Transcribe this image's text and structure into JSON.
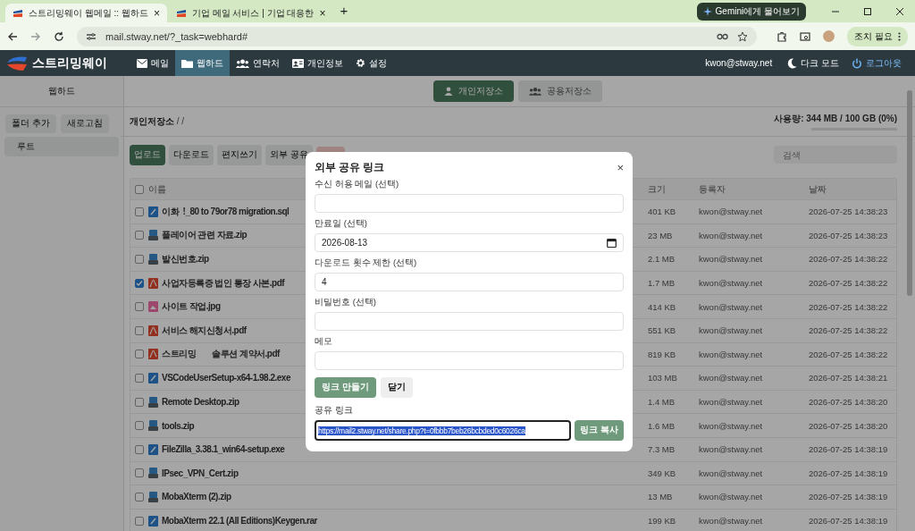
{
  "browser": {
    "tabs": [
      {
        "title": "스트리밍웨이 웹메일 :: 웹하드",
        "selected": true,
        "close": "×"
      },
      {
        "title": "기업 메일 서비스 | 기업 대응한",
        "selected": false,
        "close": "×"
      }
    ],
    "new_tab": "+",
    "gemini_button": "Gemini에게 물어보기",
    "address": "mail.stway.net/?_task=webhard#",
    "action_button": "조치 필요"
  },
  "navbar": {
    "brand": "스트리밍웨이",
    "items": [
      {
        "label": "메일",
        "selected": false
      },
      {
        "label": "웹하드",
        "selected": true
      },
      {
        "label": "연락처",
        "selected": false
      },
      {
        "label": "개인정보",
        "selected": false
      },
      {
        "label": "설정",
        "selected": false
      }
    ],
    "user": "kwon@stway.net",
    "dark_mode": "다크 모드",
    "logout": "로그아웃"
  },
  "sidebar": {
    "title": "웹하드",
    "buttons": [
      "폴더 추가",
      "새로고침"
    ],
    "tree": [
      {
        "label": "루트",
        "selected": true
      }
    ]
  },
  "storage_tabs": [
    {
      "label": "개인저장소",
      "selected": true
    },
    {
      "label": "공용저장소",
      "selected": false
    }
  ],
  "breadcrumb": {
    "root": "개인저장소",
    "path": "/ /"
  },
  "usage": {
    "text": "사용량: 344 MB / 100 GB (0%)",
    "level": 0.0
  },
  "toolbar": [
    {
      "label": "업로드",
      "kind": "primary"
    },
    {
      "label": "다운로드",
      "kind": "default"
    },
    {
      "label": "편지쓰기",
      "kind": "default"
    },
    {
      "label": "외부 공유",
      "kind": "default"
    },
    {
      "kind": "danger"
    }
  ],
  "search": {
    "placeholder": "검색"
  },
  "table": {
    "columns": [
      "이름",
      "크기",
      "등록자",
      "날짜"
    ],
    "header_checked": false,
    "rows": [
      {
        "name": "이화  !_80 to 79or78 migration.sql",
        "kind": "code",
        "size": "401 KB",
        "owner": "kwon@stway.net",
        "date": "2026-07-25 14:38:23",
        "checked": false
      },
      {
        "name": "플레이어 관련 자료.zip",
        "kind": "archive",
        "size": "23 MB",
        "owner": "kwon@stway.net",
        "date": "2026-07-25 14:38:23",
        "checked": false
      },
      {
        "name": "발신번호.zip",
        "kind": "archive",
        "size": "2.1 MB",
        "owner": "kwon@stway.net",
        "date": "2026-07-25 14:38:22",
        "checked": false
      },
      {
        "name": "사업자등록증 법인 통장 사본.pdf",
        "kind": "pdf",
        "size": "1.7 MB",
        "owner": "kwon@stway.net",
        "date": "2026-07-25 14:38:22",
        "checked": true
      },
      {
        "name": "사이트 작업.jpg",
        "kind": "image",
        "size": "414 KB",
        "owner": "kwon@stway.net",
        "date": "2026-07-25 14:38:22",
        "checked": false
      },
      {
        "name": "서비스 해지신청서.pdf",
        "kind": "pdf",
        "size": "551 KB",
        "owner": "kwon@stway.net",
        "date": "2026-07-25 14:38:22",
        "checked": false
      },
      {
        "name": "스트리밍        솔루션 계약서.pdf",
        "kind": "pdf",
        "size": "819 KB",
        "owner": "kwon@stway.net",
        "date": "2026-07-25 14:38:22",
        "checked": false
      },
      {
        "name": "VSCodeUserSetup-x64-1.98.2.exe",
        "kind": "code",
        "size": "103 MB",
        "owner": "kwon@stway.net",
        "date": "2026-07-25 14:38:21",
        "checked": false
      },
      {
        "name": "Remote Desktop.zip",
        "kind": "archive",
        "size": "1.4 MB",
        "owner": "kwon@stway.net",
        "date": "2026-07-25 14:38:20",
        "checked": false
      },
      {
        "name": "tools.zip",
        "kind": "archive",
        "size": "1.6 MB",
        "owner": "kwon@stway.net",
        "date": "2026-07-25 14:38:20",
        "checked": false
      },
      {
        "name": "FileZilla_3.38.1_win64-setup.exe",
        "kind": "code",
        "size": "7.3 MB",
        "owner": "kwon@stway.net",
        "date": "2026-07-25 14:38:19",
        "checked": false
      },
      {
        "name": "IPsec_VPN_Cert.zip",
        "kind": "archive",
        "size": "349 KB",
        "owner": "kwon@stway.net",
        "date": "2026-07-25 14:38:19",
        "checked": false
      },
      {
        "name": "MobaXterm (2).zip",
        "kind": "archive",
        "size": "13 MB",
        "owner": "kwon@stway.net",
        "date": "2026-07-25 14:38:19",
        "checked": false
      },
      {
        "name": "MobaXterm 22.1 (All Editions)Keygen.rar",
        "kind": "code",
        "size": "199 KB",
        "owner": "kwon@stway.net",
        "date": "2026-07-25 14:38:19",
        "checked": false
      }
    ]
  },
  "modal": {
    "title": "외부 공유 링크",
    "close": "×",
    "fields": [
      {
        "label": "수신 허용 메일 (선택)",
        "kind": "text"
      },
      {
        "label": "만료일 (선택)",
        "kind": "date",
        "value": "2026-08-13"
      },
      {
        "label": "다운로드 횟수 제한 (선택)",
        "kind": "text",
        "value": "4"
      },
      {
        "label": "비밀번호 (선택)",
        "kind": "text"
      },
      {
        "label": "메모",
        "kind": "text"
      }
    ],
    "buttons": [
      {
        "label": "링크 만들기",
        "kind": "primary"
      },
      {
        "label": "닫기",
        "kind": "default"
      }
    ],
    "link_label": "공유 링크",
    "link_value": "https://mail2.stway.net/share.php?t=0fbbb7beb26bcbded0c6026ca",
    "link_text_selected": true,
    "copy_button": "링크 복사"
  }
}
